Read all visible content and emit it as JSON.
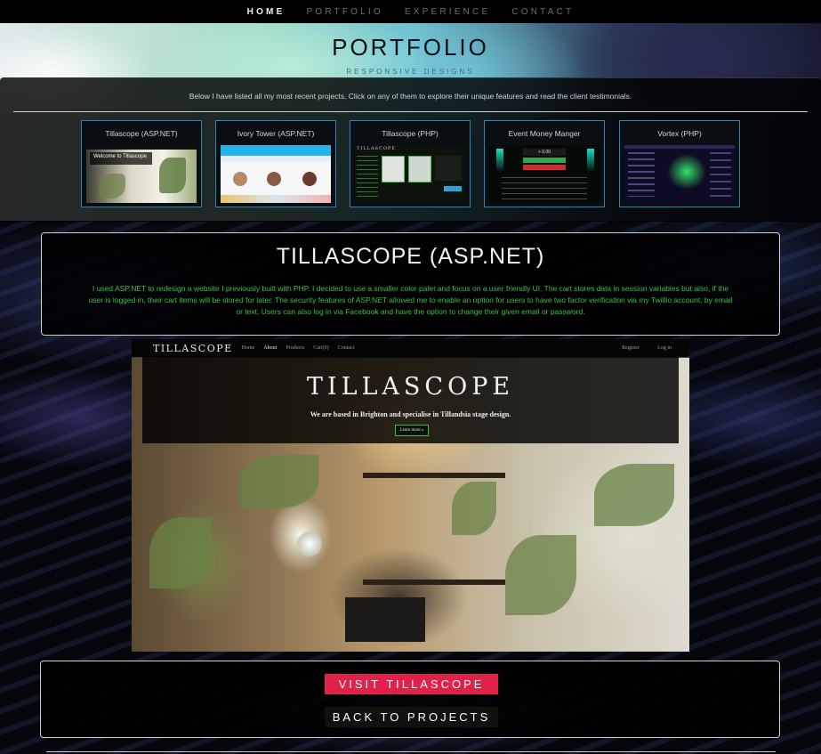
{
  "nav": {
    "items": [
      {
        "label": "HOME",
        "active": true
      },
      {
        "label": "PORTFOLIO",
        "active": false
      },
      {
        "label": "EXPERIENCE",
        "active": false
      },
      {
        "label": "CONTACT",
        "active": false
      }
    ]
  },
  "hero": {
    "title": "PORTFOLIO",
    "subtitle": "RESPONSIVE DESIGNS"
  },
  "intro": {
    "text": "Below I have listed all my most recent projects. Click on any of them to explore their unique features and read the client testimonials."
  },
  "projects": [
    {
      "title": "Tillascope (ASP.NET)",
      "thumb_text": "Welcome to Tillascope"
    },
    {
      "title": "Ivory Tower (ASP.NET)",
      "thumb_text": ""
    },
    {
      "title": "Tillascope (PHP)",
      "thumb_text": "TILLASCOPE"
    },
    {
      "title": "Event Money Manger",
      "thumb_text": "+ 0.00"
    },
    {
      "title": "Vortex (PHP)",
      "thumb_text": ""
    }
  ],
  "detail": {
    "title": "TILLASCOPE (ASP.NET)",
    "description": "I used ASP.NET to redesign a website I previously built with PHP. I decided to use a smaller color palet and focus on a user friendly UI. The cart stores data in session variables but also, if the user is logged in, their cart items will be stored for later. The security features of ASP.NET allowed me to enable an option for users to have two factor verification via my Twillio account, by email or text. Users can also log in via Facebook and have the option to change their given email or password."
  },
  "screenshot": {
    "brand": "TILLASCOPE",
    "nav_links": [
      "Home",
      "About",
      "Products",
      "Cart(0)",
      "Contact"
    ],
    "nav_right": [
      "Register",
      "Log in"
    ],
    "hero_title": "TILLASCOPE",
    "hero_subtitle": "We are based in Brighton and specialise in Tillandsia stage design.",
    "hero_button": "Learn more »"
  },
  "actions": {
    "visit_label": "VISIT TILLASCOPE",
    "back_label": "BACK TO PROJECTS"
  },
  "colors": {
    "accent_green": "#3fbf43",
    "visit_red": "#e0224b",
    "card_border": "#2a86b3"
  }
}
